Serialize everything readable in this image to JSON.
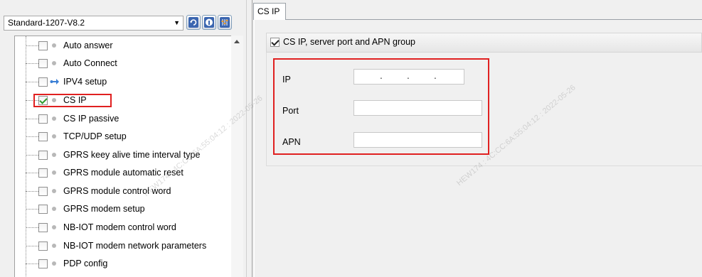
{
  "profile": {
    "selected": "Standard-1207-V8.2"
  },
  "toolbar": {
    "icons": [
      "refresh-icon",
      "info-icon",
      "settings-sliders-icon"
    ]
  },
  "tree": {
    "items": [
      {
        "label": "Auto answer",
        "checked": false,
        "icon": "bullet"
      },
      {
        "label": "Auto Connect",
        "checked": false,
        "icon": "bullet"
      },
      {
        "label": "IPV4 setup",
        "checked": false,
        "icon": "network-arrow"
      },
      {
        "label": "CS IP",
        "checked": true,
        "icon": "bullet",
        "highlighted": true
      },
      {
        "label": "CS IP passive",
        "checked": false,
        "icon": "bullet"
      },
      {
        "label": "TCP/UDP setup",
        "checked": false,
        "icon": "bullet"
      },
      {
        "label": "GPRS keey alive time interval type",
        "checked": false,
        "icon": "bullet"
      },
      {
        "label": "GPRS module automatic reset",
        "checked": false,
        "icon": "bullet"
      },
      {
        "label": "GPRS module control word",
        "checked": false,
        "icon": "bullet"
      },
      {
        "label": "GPRS modem setup",
        "checked": false,
        "icon": "bullet"
      },
      {
        "label": "NB-IOT modem control word",
        "checked": false,
        "icon": "bullet"
      },
      {
        "label": "NB-IOT modem network parameters",
        "checked": false,
        "icon": "bullet"
      },
      {
        "label": "PDP config",
        "checked": false,
        "icon": "bullet"
      }
    ]
  },
  "tab": {
    "label": "CS IP"
  },
  "group": {
    "title": "CS IP, server port and APN group",
    "checked": true,
    "fields": {
      "ip_label": "IP",
      "ip_value": "",
      "port_label": "Port",
      "port_value": "",
      "apn_label": "APN",
      "apn_value": ""
    }
  },
  "watermark": {
    "text1": "HEW174 : 4C:CC:6A:55:04:12 : 2022-05-26",
    "text2": "HEW174 : 4C:CC:6A:55:04:12 : 2022-05-26"
  },
  "colors": {
    "highlight": "#e02020",
    "check": "#2b9a2b"
  }
}
